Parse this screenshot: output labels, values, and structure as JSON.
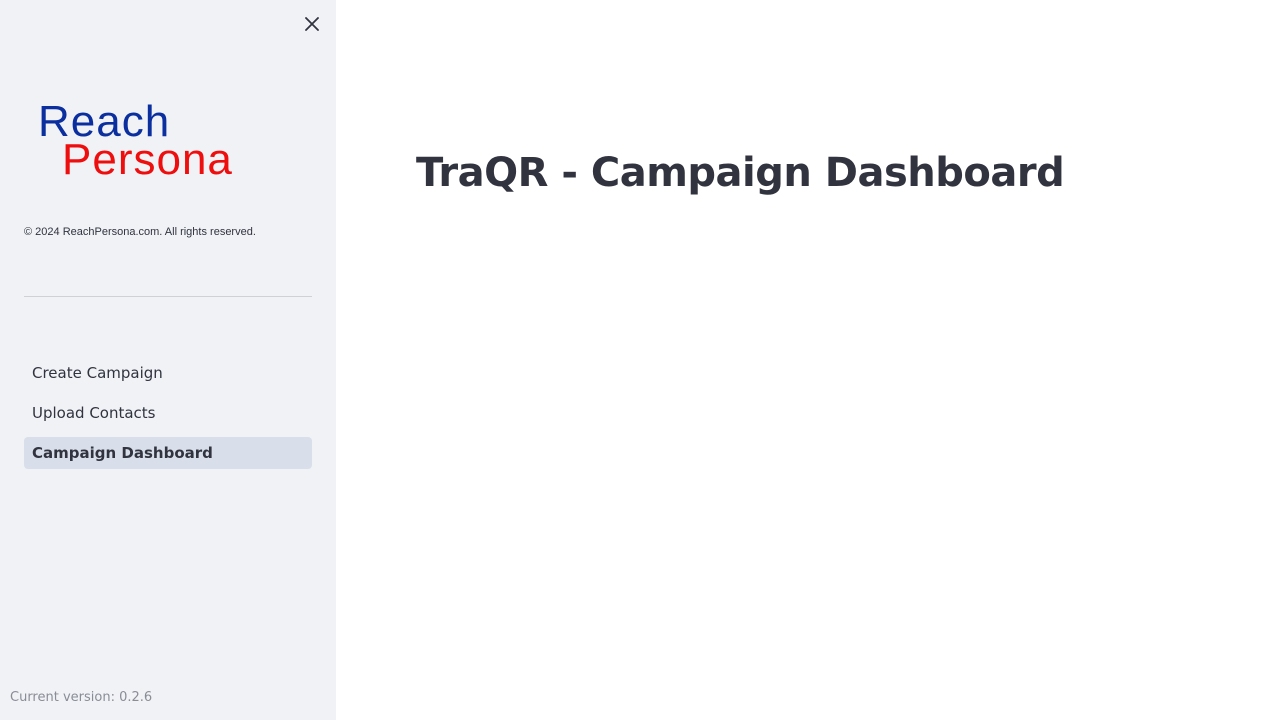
{
  "sidebar": {
    "close_icon": "close-icon",
    "logo": {
      "line1": "Reach",
      "line2": "Persona",
      "color_reach": "#0b2f9e",
      "color_persona": "#ee0e0e"
    },
    "copyright": "© 2024 ReachPersona.com. All rights reserved.",
    "nav": [
      {
        "label": "Create Campaign",
        "active": false
      },
      {
        "label": "Upload Contacts",
        "active": false
      },
      {
        "label": "Campaign Dashboard",
        "active": true
      }
    ],
    "version": "Current version: 0.2.6"
  },
  "main": {
    "title": "TraQR - Campaign Dashboard"
  },
  "colors": {
    "sidebar_bg": "#f0f2f6",
    "active_item_bg": "#d8dfea",
    "text": "#31333f",
    "muted_text": "#8a8d96"
  }
}
